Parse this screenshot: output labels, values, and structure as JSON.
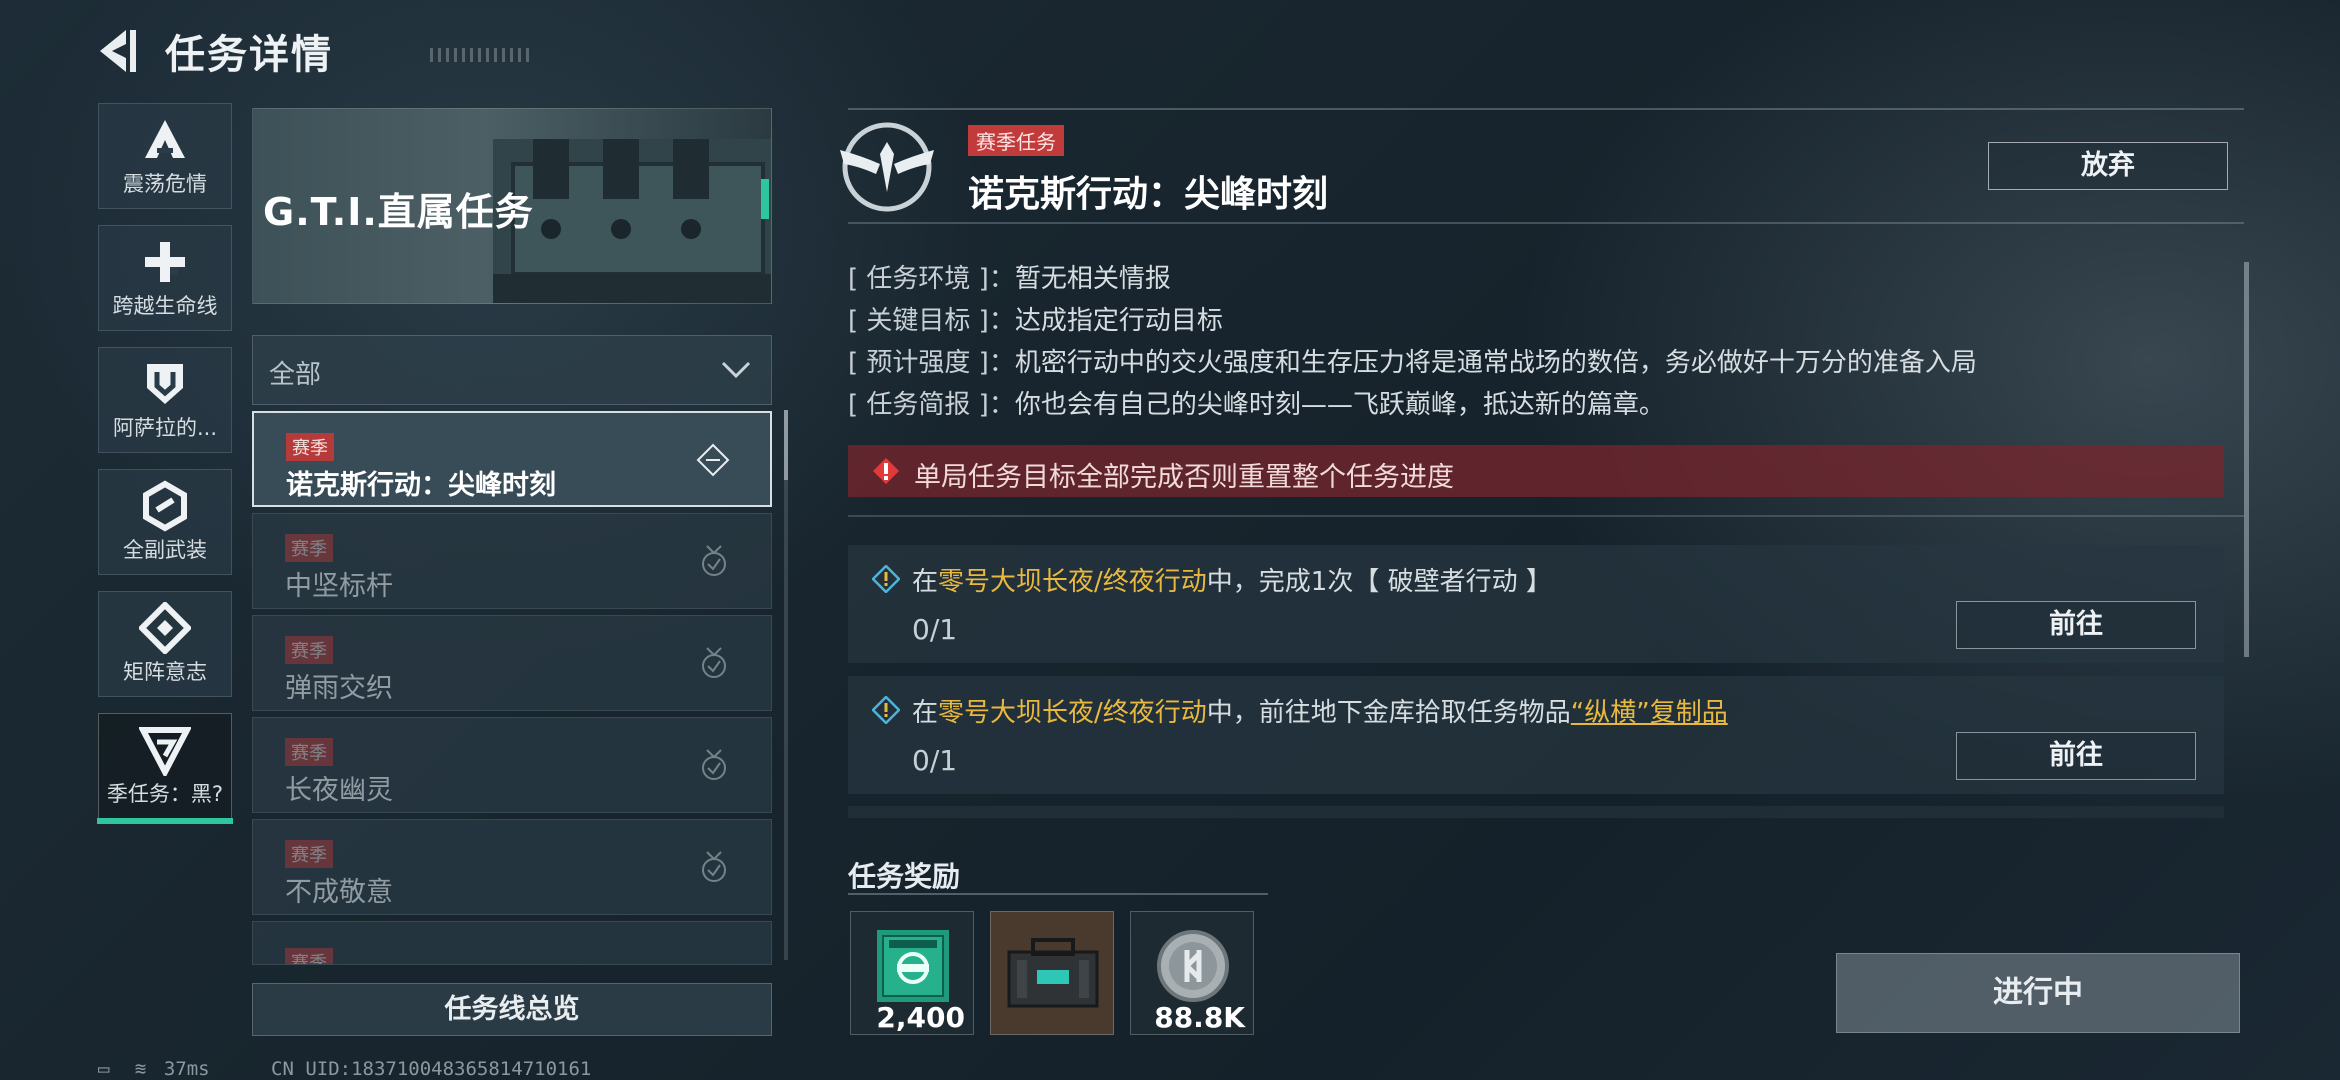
{
  "header": {
    "title": "任务详情"
  },
  "rail": [
    {
      "label": "震荡危情",
      "icon": "triangle-a-icon"
    },
    {
      "label": "跨越生命线",
      "icon": "cross-plus-icon"
    },
    {
      "label": "阿萨拉的...",
      "icon": "shield-icon"
    },
    {
      "label": "全副武装",
      "icon": "hexagon-link-icon"
    },
    {
      "label": "矩阵意志",
      "icon": "diamond-matrix-icon"
    },
    {
      "label": "季任务：黑?",
      "icon": "season-g-icon",
      "active": true
    }
  ],
  "banner": {
    "title": "G.T.I.直属任务"
  },
  "filter": {
    "value": "全部"
  },
  "tasks": [
    {
      "tag": "赛季",
      "name": "诺克斯行动：尖峰时刻",
      "selected": true
    },
    {
      "tag": "赛季",
      "name": "中坚标杆"
    },
    {
      "tag": "赛季",
      "name": "弹雨交织"
    },
    {
      "tag": "赛季",
      "name": "长夜幽灵"
    },
    {
      "tag": "赛季",
      "name": "不成敬意"
    },
    {
      "tag": "赛季",
      "name": ""
    }
  ],
  "overview_button": "任务线总览",
  "status": {
    "ping": "37ms",
    "uid": "CN UID:1837100483658147101​61"
  },
  "mission": {
    "tag": "赛季任务",
    "title": "诺克斯行动：尖峰时刻",
    "abandon": "放弃",
    "info": [
      {
        "key": "[ 任务环境 ]：",
        "value": "暂无相关情报"
      },
      {
        "key": "[ 关键目标 ]：",
        "value": "达成指定行动目标"
      },
      {
        "key": "[ 预计强度 ]：",
        "value": "机密行动中的交火强度和生存压力将是通常战场的数倍，务必做好十万分的准备入局"
      },
      {
        "key": "[ 任务简报 ]：",
        "value": "你也会有自己的尖峰时刻——飞跃巅峰，抵达新的篇章。"
      }
    ],
    "warning": "单局任务目标全部完成否则重置整个任务进度",
    "objectives": [
      {
        "pre": "在",
        "hl": "零号大坝长夜/终夜行动",
        "mid": "中，完成1次【 破壁者行动 】",
        "ul": "",
        "progress": "0/1",
        "button": "前往"
      },
      {
        "pre": "在",
        "hl": "零号大坝长夜/终夜行动",
        "mid": "中，前往地下金库拾取任务物品",
        "ul": "“纵横”复制品",
        "progress": "0/1",
        "button": "前往"
      }
    ],
    "rewards_title": "任务奖励",
    "rewards": [
      {
        "icon": "green-badge-icon",
        "value": "2,400"
      },
      {
        "icon": "equipment-case-icon",
        "value": ""
      },
      {
        "icon": "silver-coin-icon",
        "value": "88.8K"
      }
    ],
    "progress_button": "进行中"
  },
  "colors": {
    "accent": "#2ec69e",
    "highlight": "#e8b93e",
    "warning_bg": "#78262c",
    "tag": "#c13b3b"
  }
}
